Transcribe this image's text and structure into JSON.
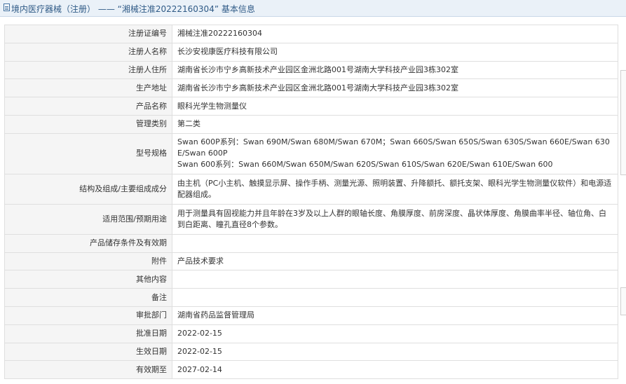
{
  "header": {
    "title": "境内医疗器械（注册） —— “湘械注准20222160304” 基本信息"
  },
  "rows": [
    {
      "label": "注册证编号",
      "value": "湘械注准20222160304"
    },
    {
      "label": "注册人名称",
      "value": "长沙安视康医疗科技有限公司"
    },
    {
      "label": "注册人住所",
      "value": "湖南省长沙市宁乡高新技术产业园区金洲北路001号湖南大学科技产业园3栋302室"
    },
    {
      "label": "生产地址",
      "value": "湖南省长沙市宁乡高新技术产业园区金洲北路001号湖南大学科技产业园3栋302室"
    },
    {
      "label": "产品名称",
      "value": "眼科光学生物测量仪"
    },
    {
      "label": "管理类别",
      "value": "第二类"
    },
    {
      "label": "型号规格",
      "value": "",
      "lines": [
        "Swan 600P系列：Swan 690M/Swan 680M/Swan 670M；Swan 660S/Swan 650S/Swan 630S/Swan 660E/Swan 630E/Swan 600P",
        "Swan 600系列：Swan 660M/Swan 650M/Swan 620S/Swan 610S/Swan 620E/Swan 610E/Swan 600"
      ]
    },
    {
      "label": "结构及组成/主要组成成分",
      "value": "由主机（PC小主机、触摸显示屏、操作手柄、测量光源、照明装置、升降额托、额托支架、眼科光学生物测量仪软件）和电源适配器组成。"
    },
    {
      "label": "适用范围/预期用途",
      "value": "用于测量具有固视能力并且年龄在3岁及以上人群的眼轴长度、角膜厚度、前房深度、晶状体厚度、角膜曲率半径、轴位角、白到白距离、瞳孔直径8个参数。"
    },
    {
      "label": "产品储存条件及有效期",
      "value": ""
    },
    {
      "label": "附件",
      "value": "产品技术要求"
    },
    {
      "label": "其他内容",
      "value": ""
    },
    {
      "label": "备注",
      "value": ""
    },
    {
      "label": "审批部门",
      "value": "湖南省药品监督管理局"
    },
    {
      "label": "批准日期",
      "value": "2022-02-15"
    },
    {
      "label": "生效日期",
      "value": "2022-02-15"
    },
    {
      "label": "有效期至",
      "value": "2027-02-14"
    }
  ]
}
